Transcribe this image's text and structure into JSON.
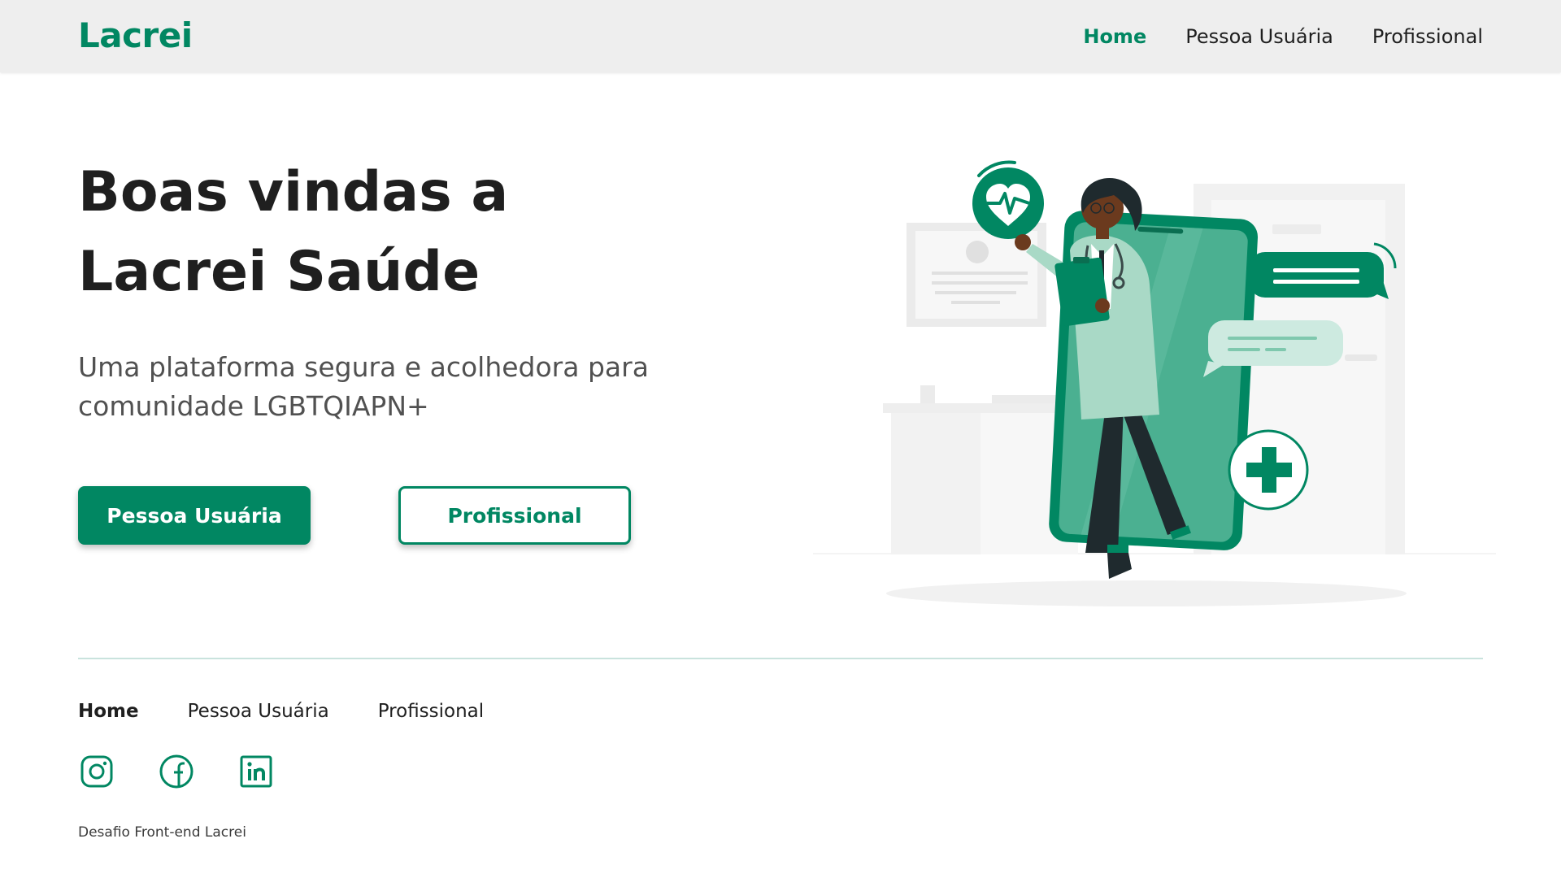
{
  "header": {
    "logo": "Lacrei",
    "nav": [
      {
        "label": "Home",
        "active": true
      },
      {
        "label": "Pessoa Usuária",
        "active": false
      },
      {
        "label": "Profissional",
        "active": false
      }
    ]
  },
  "hero": {
    "title": "Boas vindas a Lacrei Saúde",
    "subtitle": "Uma plataforma segura e acolhedora para comunidade LGBTQIAPN+",
    "primary_button": "Pessoa Usuária",
    "secondary_button": "Profissional"
  },
  "footer": {
    "nav": [
      {
        "label": "Home",
        "active": true
      },
      {
        "label": "Pessoa Usuária",
        "active": false
      },
      {
        "label": "Profissional",
        "active": false
      }
    ],
    "social_icons": [
      "instagram-icon",
      "facebook-icon",
      "linkedin-icon"
    ],
    "copyright": "Desafio Front-end Lacrei"
  },
  "colors": {
    "brand": "#018762",
    "header_bg": "#eeeeee",
    "text": "#1f1f1f",
    "subtext": "#515151"
  }
}
